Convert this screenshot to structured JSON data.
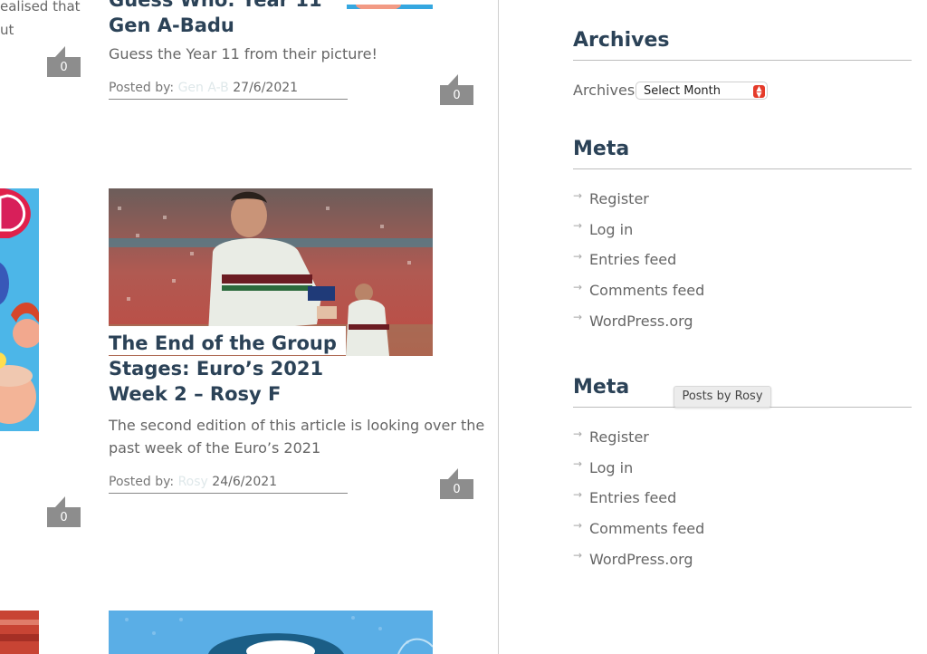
{
  "left_cut": {
    "line1": "ealised that",
    "line2": "ut"
  },
  "posts": [
    {
      "title_lines": [
        "Guess Who: Year 11",
        "Gen A-Badu"
      ],
      "excerpt": "Guess the Year 11 from their picture!",
      "posted_by_label": "Posted by:",
      "author": "Gen A-B",
      "date": "27/6/2021",
      "comments": "0"
    },
    {
      "image_alt": "Footballer in Portugal kit at a crowded stadium",
      "title_lines": [
        "The End of the Group",
        "Stages: Euro’s 2021",
        "Week 2 – Rosy F"
      ],
      "excerpt_lines": [
        "The second edition of this article is looking over the",
        "past week of the Euro’s 2021"
      ],
      "posted_by_label": "Posted by:",
      "author": "Rosy",
      "date": "24/6/2021",
      "comments": "0"
    }
  ],
  "left_comment_counts": [
    "0",
    "0"
  ],
  "sidebar": {
    "archives": {
      "title": "Archives",
      "label": "Archives",
      "select_value": "Select Month"
    },
    "meta1": {
      "title": "Meta",
      "items": [
        "Register",
        "Log in",
        "Entries feed",
        "Comments feed",
        "WordPress.org"
      ]
    },
    "meta2": {
      "title": "Meta",
      "items": [
        "Register",
        "Log in",
        "Entries feed",
        "Comments feed",
        "WordPress.org"
      ]
    }
  },
  "tooltip": "Posts by Rosy",
  "colors": {
    "heading": "#2b4257",
    "comment_badge": "#8d8d8d",
    "select_accent": "#e53b2a",
    "tooltip_bg": "#ececec"
  }
}
